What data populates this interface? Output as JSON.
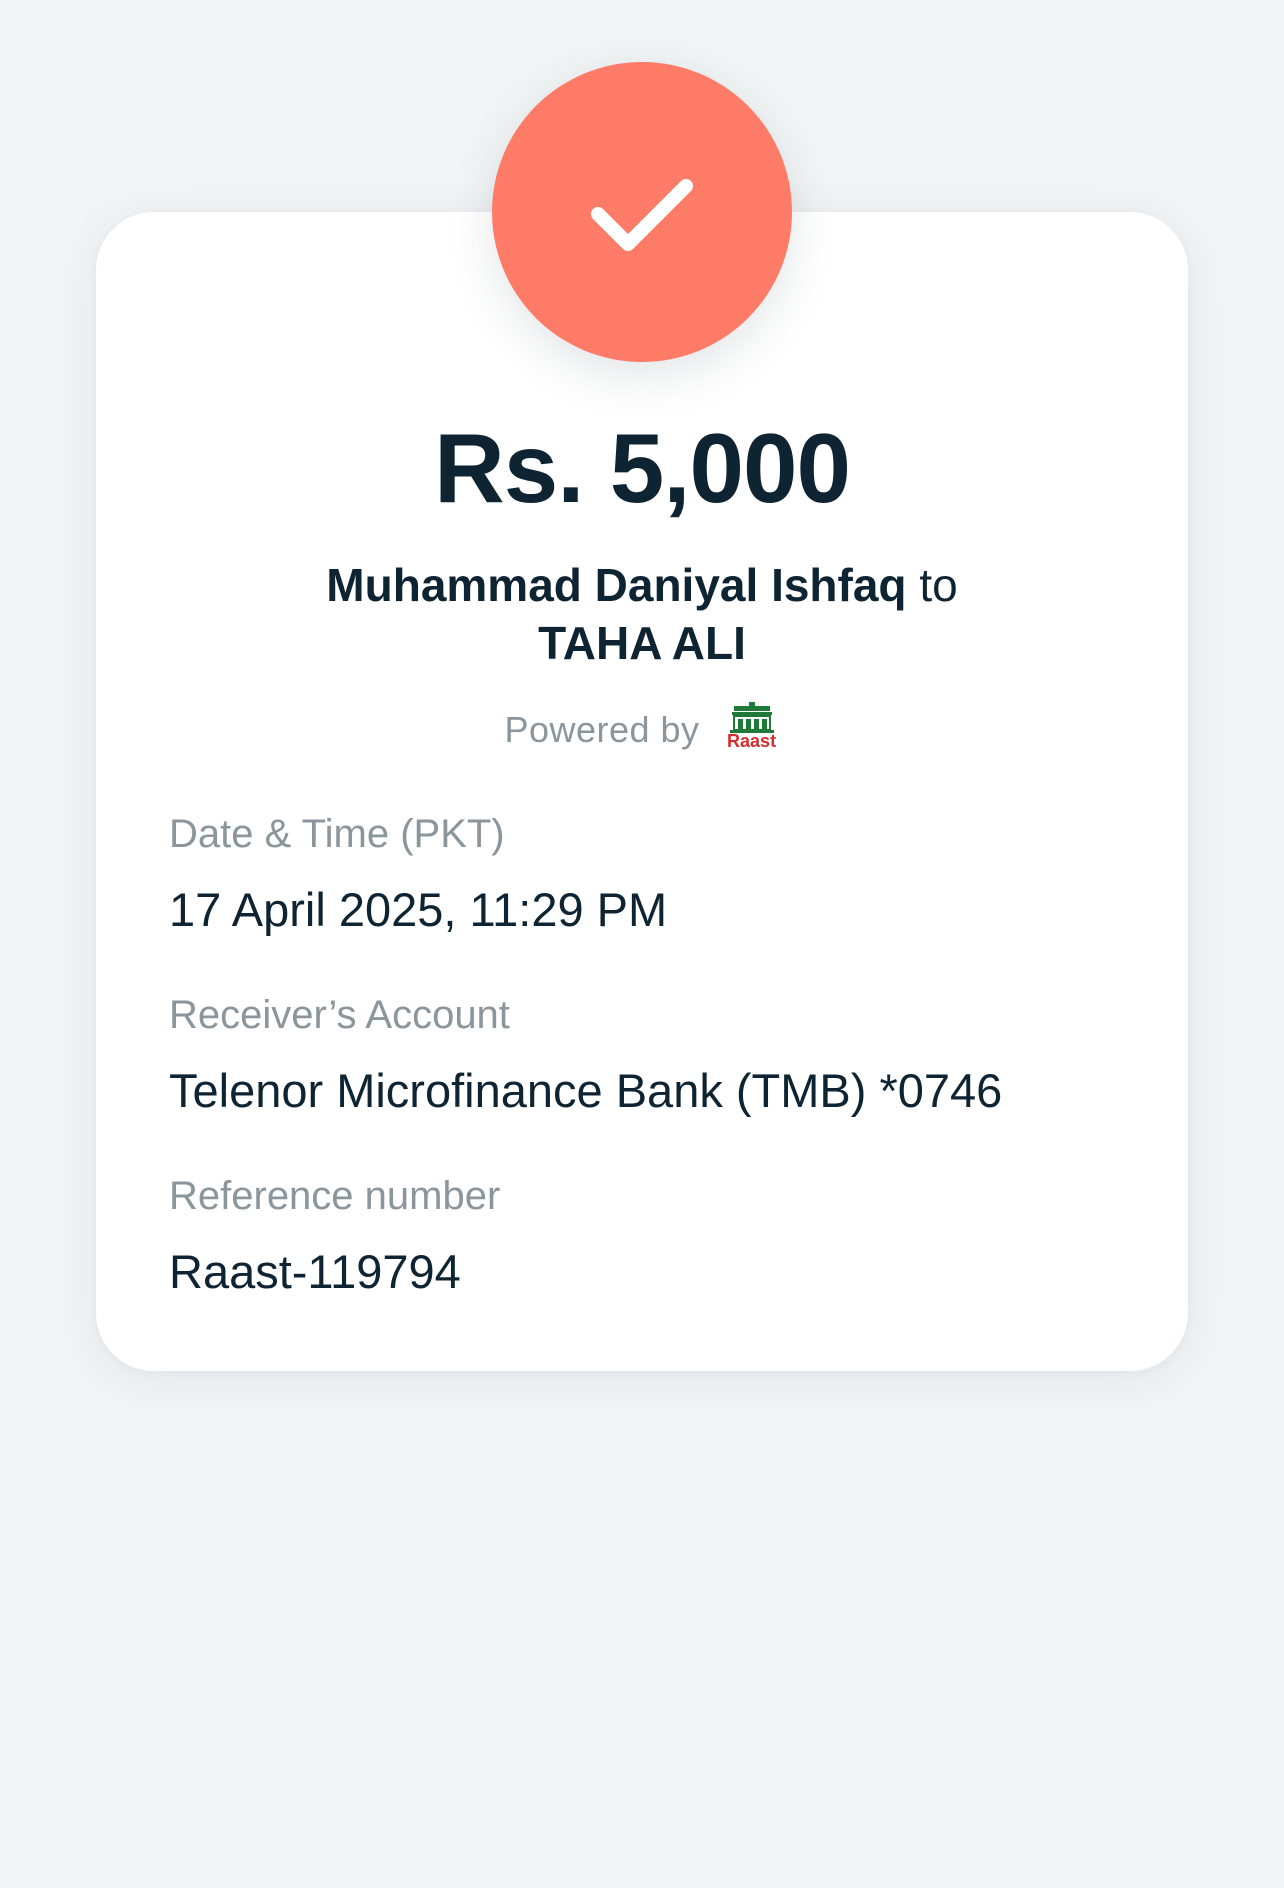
{
  "receipt": {
    "amount": "Rs. 5,000",
    "sender": "Muhammad Daniyal Ishfaq",
    "connector": "to",
    "receiver": "TAHA ALI",
    "powered_by": "Powered by",
    "provider_logo_text": "Raast"
  },
  "details": [
    {
      "label": "Date & Time (PKT)",
      "value": "17 April 2025, 11:29 PM"
    },
    {
      "label": "Receiver’s Account",
      "value": "Telenor Microfinance Bank (TMB) *0746"
    },
    {
      "label": "Reference number",
      "value": "Raast-119794"
    }
  ],
  "colors": {
    "background": "#f1f4f5",
    "card": "#ffffff",
    "success_badge": "#fe7b68",
    "primary_text": "#0f2433",
    "secondary_text": "#8a959c",
    "raast_green": "#1f7a3a",
    "raast_red": "#d42e2e"
  },
  "icons": {
    "success": "check-icon",
    "provider": "raast-logo-icon"
  }
}
